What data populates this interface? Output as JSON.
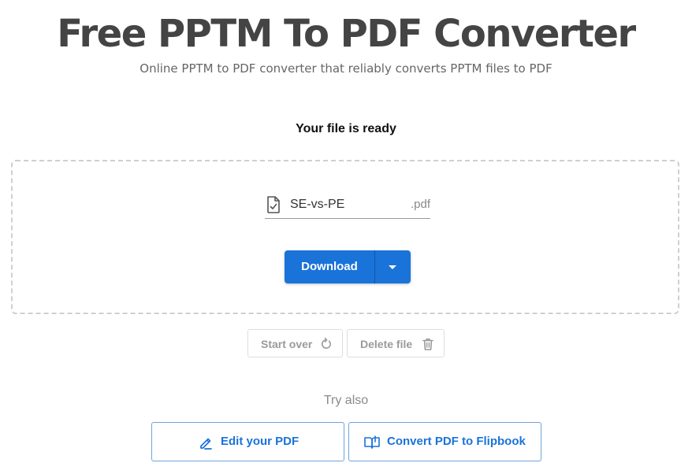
{
  "header": {
    "title": "Free PPTM To PDF Converter",
    "subtitle": "Online PPTM to PDF converter that reliably converts PPTM files to PDF"
  },
  "status": {
    "message": "Your file is ready"
  },
  "file": {
    "name": "SE-vs-PE",
    "extension": ".pdf"
  },
  "actions": {
    "download_label": "Download",
    "start_over_label": "Start over",
    "delete_file_label": "Delete file"
  },
  "try_also": {
    "heading": "Try also",
    "items": [
      {
        "label": "Edit your PDF",
        "icon": "pencil-icon"
      },
      {
        "label": "Convert PDF to Flipbook",
        "icon": "book-icon"
      }
    ]
  },
  "colors": {
    "accent": "#1a73d9",
    "title": "#444444",
    "muted": "#9a9a9a"
  }
}
